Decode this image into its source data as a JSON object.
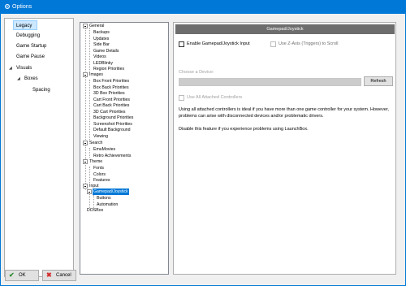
{
  "window": {
    "title": "Options"
  },
  "colors": {
    "accent": "#0078d7",
    "ok_icon": "#2e8b2e",
    "cancel_icon": "#d32f2f",
    "header_bg": "#6d6d6d"
  },
  "categories": {
    "items": [
      {
        "label": "Legacy",
        "selected": true
      },
      {
        "label": "Debugging"
      },
      {
        "label": "Game Startup"
      },
      {
        "label": "Game Pause"
      },
      {
        "label": "Visuals",
        "expanded": true
      },
      {
        "label": "Boxes",
        "expanded": true
      },
      {
        "label": "Spacing"
      }
    ]
  },
  "tree": {
    "general": {
      "label": "General",
      "children": [
        "Backups",
        "Updates",
        "Side Bar",
        "Game Details",
        "Videos",
        "LEDBlinky",
        "Region Priorities"
      ]
    },
    "images": {
      "label": "Images",
      "children": [
        "Box Front Priorities",
        "Box Back Priorities",
        "3D Box Priorities",
        "Cart Front Priorities",
        "Cart Back Priorities",
        "3D Cart Priorities",
        "Background Priorities",
        "Screenshot Priorities",
        "Default Background",
        "Viewing"
      ]
    },
    "search": {
      "label": "Search",
      "children": [
        "EmuMovies",
        "Retro Achievements"
      ]
    },
    "theme": {
      "label": "Theme",
      "children": [
        "Fonts",
        "Colors",
        "Features"
      ]
    },
    "input": {
      "label": "Input",
      "children": [
        "Buttons",
        "Automation"
      ]
    },
    "gamepad": {
      "label": "Gamepad/Joystick",
      "selected": true
    },
    "dosbox": {
      "label": "DOSBox"
    }
  },
  "settings": {
    "header": "Gamepad/Joystick",
    "enable_gamepad": {
      "label": "Enable Gamepad/Joystick Input",
      "checked": false
    },
    "use_z_axis": {
      "label": "Use Z-Axis (Triggers) to Scroll",
      "checked": false,
      "enabled": false
    },
    "device_label": "Choose a Device:",
    "device_value": "",
    "refresh_label": "Refresh",
    "use_all": {
      "label": "Use All Attached Controllers",
      "checked": false,
      "enabled": false
    },
    "info_1": "Using all attached controllers is ideal if you have more than one game controller for your system. However, problems can arise with disconnected devices and/or problematic drivers.",
    "info_2": "Disable this feature if you experience problems using LaunchBox."
  },
  "buttons": {
    "ok_label": "OK",
    "cancel_label": "Cancel"
  },
  "icons": {
    "app": "gear-icon",
    "ok": "check-icon",
    "cancel": "cross-icon",
    "expanded": "triangle-down-icon",
    "tree_expanded": "minus-box-icon"
  }
}
